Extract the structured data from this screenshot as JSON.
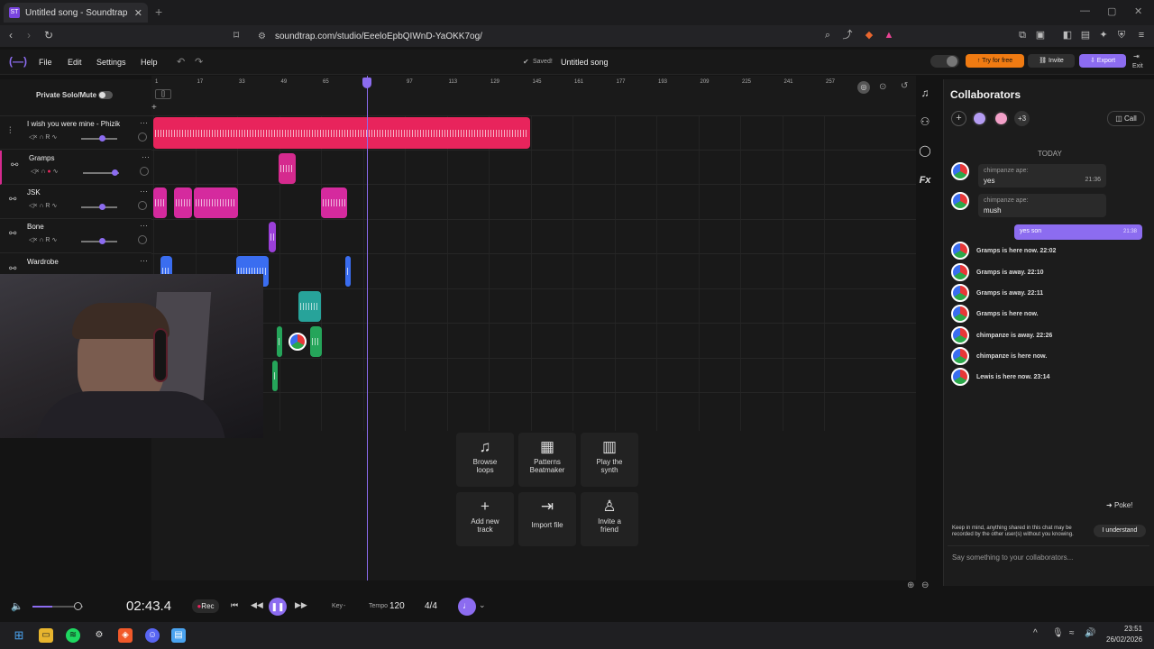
{
  "browser": {
    "tab_title": "Untitled song - Soundtrap",
    "url": "soundtrap.com/studio/EeeloEpbQIWnD-YaOKK7og/"
  },
  "menu": {
    "file": "File",
    "edit": "Edit",
    "settings": "Settings",
    "help": "Help"
  },
  "status": {
    "saved": "Saved!",
    "song_title": "Untitled song"
  },
  "top_buttons": {
    "try": "Try for free",
    "invite": "Invite",
    "export": "Export",
    "exit": "Exit"
  },
  "tracks_header": {
    "private_solo": "Private Solo/Mute",
    "add": "+"
  },
  "tracks": [
    {
      "name": "I wish you were mine - Phizik",
      "color": "#e8245c"
    },
    {
      "name": "Gramps",
      "color": "#d52a8e"
    },
    {
      "name": "JSK",
      "color": "#d52a9e"
    },
    {
      "name": "Bone",
      "color": "#9a3fd8"
    },
    {
      "name": "Wardrobe",
      "color": "#3a6df0"
    }
  ],
  "track_controls": {
    "rec": "R"
  },
  "ruler": [
    "1",
    "17",
    "33",
    "49",
    "65",
    "81",
    "97",
    "113",
    "129",
    "145",
    "161",
    "177",
    "193",
    "209",
    "225",
    "241",
    "257"
  ],
  "actions": [
    {
      "label1": "Browse",
      "label2": "loops",
      "icon": "♫"
    },
    {
      "label1": "Patterns",
      "label2": "Beatmaker",
      "icon": "▦"
    },
    {
      "label1": "Play the",
      "label2": "synth",
      "icon": "▥"
    },
    {
      "label1": "Add new",
      "label2": "track",
      "icon": "+"
    },
    {
      "label1": "Import file",
      "label2": "",
      "icon": "⇥"
    },
    {
      "label1": "Invite a",
      "label2": "friend",
      "icon": "♙"
    }
  ],
  "tools": {
    "fx": "Fx"
  },
  "collab": {
    "title": "Collaborators",
    "extra_count": "+3",
    "call": "Call",
    "date": "TODAY",
    "messages": [
      {
        "sender": "chimpanze ape:",
        "text": "yes",
        "time": "21:36"
      },
      {
        "sender": "chimpanze ape:",
        "text": "mush",
        "time": ""
      }
    ],
    "own_message": {
      "text": "yes son",
      "time": "21:38"
    },
    "presence": [
      "Gramps is here now. 22:02",
      "Gramps is away. 22:10",
      "Gramps is away. 22:11",
      "Gramps is here now.",
      "chimpanze is away. 22:26",
      "chimpanze is here now.",
      "Lewis is here now. 23:14"
    ],
    "poke": "Poke!",
    "notice": "Keep in mind, anything shared in this chat may be recorded by the other user(s) without you knowing.",
    "understand": "I understand",
    "input_placeholder": "Say something to your collaborators..."
  },
  "transport": {
    "time": "02:43.4",
    "rec": "Rec",
    "key_label": "Key",
    "key_value": "-",
    "tempo_label": "Tempo",
    "tempo_value": "120",
    "time_sig": "4/4"
  },
  "system": {
    "time": "23:51",
    "date": "26/02/2026"
  }
}
